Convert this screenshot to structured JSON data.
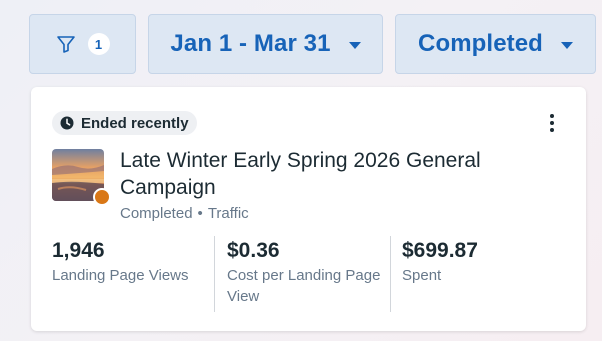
{
  "filters": {
    "filter_count": "1",
    "date_range": "Jan 1 - Mar 31",
    "status": "Completed"
  },
  "card": {
    "badge": "Ended recently",
    "title": "Late Winter Early Spring 2026 General Campaign",
    "meta_status": "Completed",
    "meta_separator": "•",
    "meta_objective": "Traffic",
    "metrics": [
      {
        "value": "1,946",
        "label": "Landing Page Views"
      },
      {
        "value": "$0.36",
        "label": "Cost per Landing Page View"
      },
      {
        "value": "$699.87",
        "label": "Spent"
      }
    ]
  },
  "colors": {
    "accent": "#1763b8",
    "chip_bg": "#dde7f3",
    "status_dot": "#d97716",
    "text_primary": "#1c2b33",
    "text_secondary": "#67788a"
  },
  "icons": {
    "filter": "funnel-icon",
    "dropdown": "caret-down-icon",
    "ended": "clock-icon",
    "more": "more-vertical-icon"
  }
}
